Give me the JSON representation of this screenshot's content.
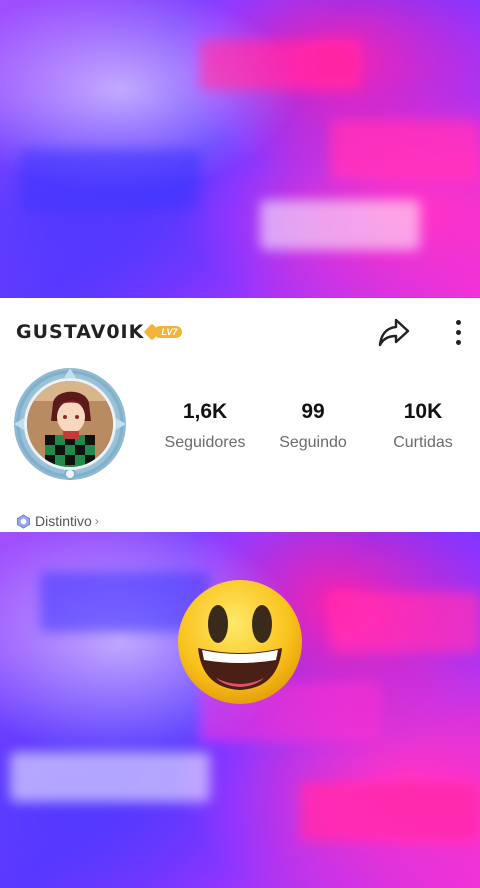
{
  "profile": {
    "username": "GUSTAV0IK",
    "level": "LV7"
  },
  "stats": [
    {
      "value": "1,6K",
      "label": "Seguidores"
    },
    {
      "value": "99",
      "label": "Seguindo"
    },
    {
      "value": "10K",
      "label": "Curtidas"
    }
  ],
  "badge": {
    "label": "Distintivo",
    "chevron": "›"
  },
  "icons": {
    "share": "share-arrow-icon",
    "more": "more-vertical-icon",
    "emoji": "grinning-face-icon"
  },
  "colors": {
    "level_badge": "#f2b43a",
    "background_accent": "#6a3cf0"
  }
}
